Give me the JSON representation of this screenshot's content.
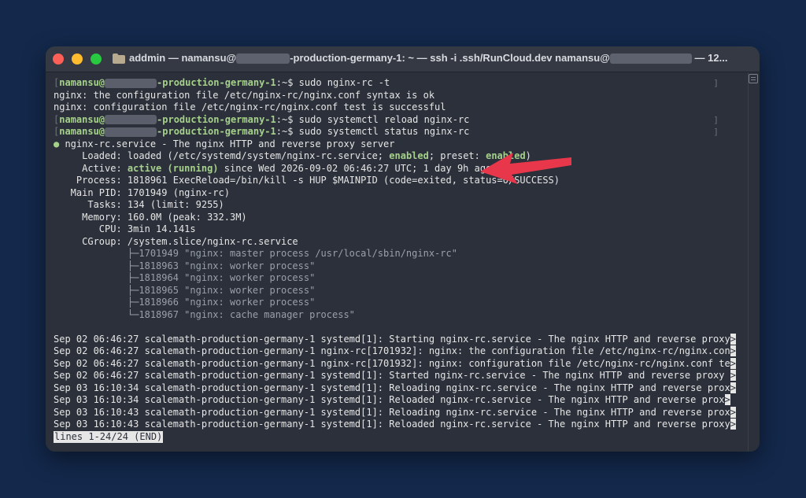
{
  "window": {
    "title_pre": "addmin — namansu@",
    "title_mid": "-production-germany-1: ~ — ssh -i .ssh/RunCloud.dev namansu@",
    "title_end": " — 12..."
  },
  "terminal": {
    "prompt_user": "namansu@",
    "prompt_host_suffix": "-production-germany-1",
    "prompt_tail": ":~$ ",
    "cmd1": "sudo nginx-rc -t",
    "out1": "nginx: the configuration file /etc/nginx-rc/nginx.conf syntax is ok",
    "out2": "nginx: configuration file /etc/nginx-rc/nginx.conf test is successful",
    "cmd2": "sudo systemctl reload nginx-rc",
    "cmd3": "sudo systemctl status nginx-rc",
    "service_dot": "●",
    "service_line": " nginx-rc.service - The nginx HTTP and reverse proxy server",
    "loaded_label": "     Loaded: ",
    "loaded_pre": "loaded (/etc/systemd/system/nginx-rc.service; ",
    "loaded_enabled": "enabled",
    "loaded_mid": "; preset: ",
    "loaded_preset": "enabled",
    "loaded_post": ")",
    "active_label": "     Active: ",
    "active_state": "active (running)",
    "active_post": " since Wed 2026-09-02 06:46:27 UTC; 1 day 9h ago",
    "process": "    Process: 1818961 ExecReload=/bin/kill -s HUP $MAINPID (code=exited, status=0/SUCCESS)",
    "mainpid": "   Main PID: 1701949 (nginx-rc)",
    "tasks": "      Tasks: 134 (limit: 9255)",
    "memory": "     Memory: 160.0M (peak: 332.3M)",
    "cpu": "        CPU: 3min 14.141s",
    "cgroup": "     CGroup: /system.slice/nginx-rc.service",
    "tree": [
      "             ├─1701949 \"nginx: master process /usr/local/sbin/nginx-rc\"",
      "             ├─1818963 \"nginx: worker process\"",
      "             ├─1818964 \"nginx: worker process\"",
      "             ├─1818965 \"nginx: worker process\"",
      "             ├─1818966 \"nginx: worker process\"",
      "             └─1818967 \"nginx: cache manager process\""
    ],
    "logs": [
      "Sep 02 06:46:27 scalemath-production-germany-1 systemd[1]: Starting nginx-rc.service - The nginx HTTP and reverse proxy",
      "Sep 02 06:46:27 scalemath-production-germany-1 nginx-rc[1701932]: nginx: the configuration file /etc/nginx-rc/nginx.con",
      "Sep 02 06:46:27 scalemath-production-germany-1 nginx-rc[1701932]: nginx: configuration file /etc/nginx-rc/nginx.conf te",
      "Sep 02 06:46:27 scalemath-production-germany-1 systemd[1]: Started nginx-rc.service - The nginx HTTP and reverse proxy ",
      "Sep 03 16:10:34 scalemath-production-germany-1 systemd[1]: Reloading nginx-rc.service - The nginx HTTP and reverse prox",
      "Sep 03 16:10:34 scalemath-production-germany-1 systemd[1]: Reloaded nginx-rc.service - The nginx HTTP and reverse prox",
      "Sep 03 16:10:43 scalemath-production-germany-1 systemd[1]: Reloading nginx-rc.service - The nginx HTTP and reverse prox",
      "Sep 03 16:10:43 scalemath-production-germany-1 systemd[1]: Reloaded nginx-rc.service - The nginx HTTP and reverse proxy"
    ],
    "trunc_marker": ">",
    "pager_status": "lines 1-24/24 (END)"
  },
  "colors": {
    "background": "#13284b",
    "terminal_bg": "#2b303a",
    "accent_green": "#a6d18b",
    "arrow_red": "#e8374a"
  },
  "icons": [
    "folder-icon",
    "arrow-annotation-icon",
    "scrollbar-menu-icon"
  ]
}
